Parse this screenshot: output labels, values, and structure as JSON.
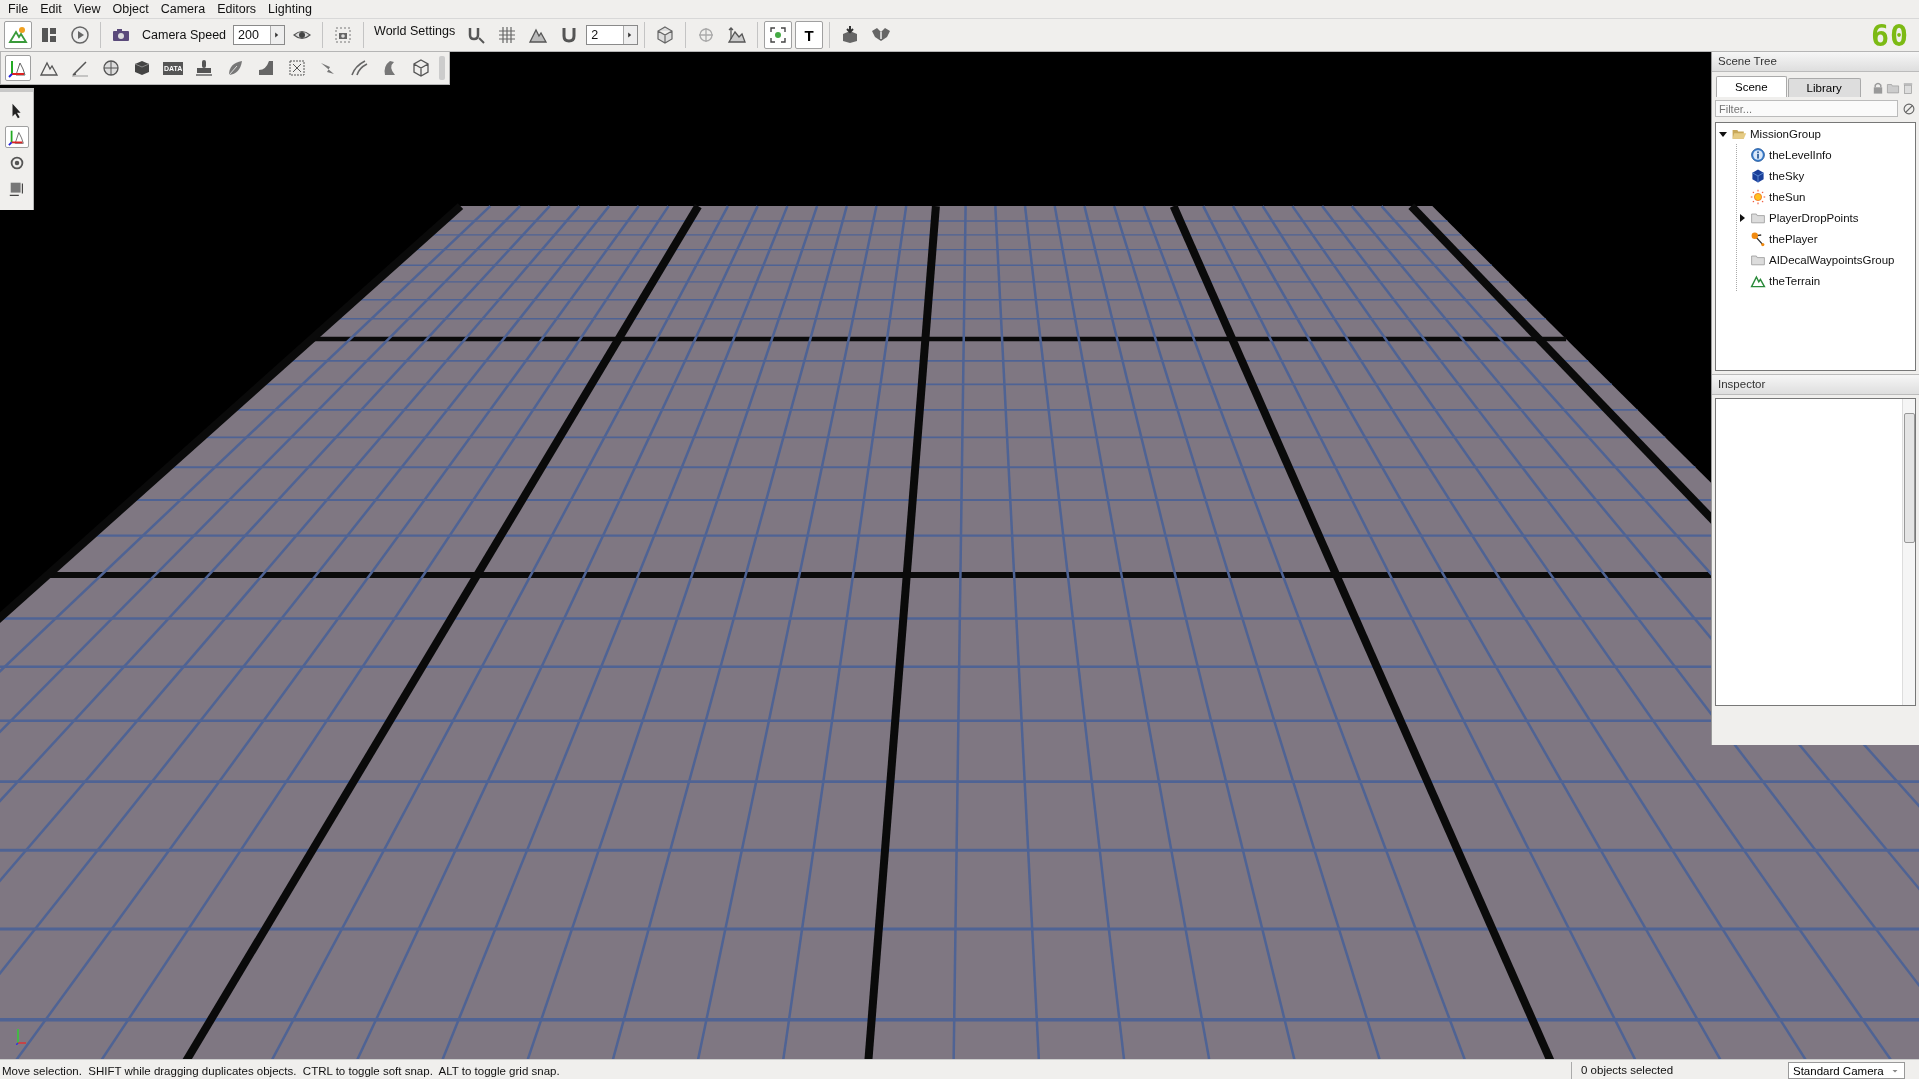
{
  "menu_bar": [
    "File",
    "Edit",
    "View",
    "Object",
    "Camera",
    "Editors",
    "Lighting"
  ],
  "main_toolbar": [
    {
      "kind": "button",
      "selected": true
    },
    {
      "kind": "button",
      "selected": false
    },
    {
      "kind": "button",
      "selected": false
    },
    {
      "kind": "separator"
    },
    {
      "kind": "button",
      "selected": false
    },
    {
      "kind": "label",
      "text": "Camera Speed"
    },
    {
      "kind": "spin",
      "value": "200"
    },
    {
      "kind": "button",
      "selected": false
    },
    {
      "kind": "separator"
    },
    {
      "kind": "button",
      "selected": false
    },
    {
      "kind": "separator"
    },
    {
      "kind": "label",
      "text": "World Settings"
    },
    {
      "kind": "button",
      "selected": false
    },
    {
      "kind": "button",
      "selected": false
    },
    {
      "kind": "button",
      "selected": false
    },
    {
      "kind": "button",
      "selected": false
    },
    {
      "kind": "spin",
      "value": "2"
    },
    {
      "kind": "separator"
    },
    {
      "kind": "button",
      "selected": false
    },
    {
      "kind": "separator"
    },
    {
      "kind": "button",
      "selected": false
    },
    {
      "kind": "button",
      "selected": false
    },
    {
      "kind": "separator"
    },
    {
      "kind": "button",
      "selected": true
    },
    {
      "kind": "button",
      "selected": true,
      "text": "T"
    },
    {
      "kind": "separator"
    },
    {
      "kind": "button",
      "selected": false
    },
    {
      "kind": "button",
      "selected": false
    }
  ],
  "fps": "60",
  "tool_palette": [
    {
      "selected": true
    },
    {
      "selected": false
    },
    {
      "selected": false
    },
    {
      "selected": false
    },
    {
      "selected": false
    },
    {
      "selected": false,
      "text": "DATA"
    },
    {
      "selected": false
    },
    {
      "selected": false
    },
    {
      "selected": false
    },
    {
      "selected": false
    },
    {
      "selected": false
    },
    {
      "selected": false
    },
    {
      "selected": false
    },
    {
      "selected": false
    }
  ],
  "side_toolbar": [
    {
      "selected": false
    },
    {
      "selected": true
    },
    {
      "selected": false
    },
    {
      "selected": false
    }
  ],
  "scene_tree": {
    "title": "Scene Tree",
    "tabs": [
      {
        "label": "Scene",
        "selected": true
      },
      {
        "label": "Library",
        "selected": false
      }
    ],
    "filter": {
      "placeholder": "Filter..."
    },
    "items": [
      {
        "label": "MissionGroup",
        "kind": "group",
        "expanded": true,
        "children": [
          {
            "label": "theLevelInfo",
            "kind": "level-info"
          },
          {
            "label": "theSky",
            "kind": "sky"
          },
          {
            "label": "theSun",
            "kind": "sun"
          },
          {
            "label": "PlayerDropPoints",
            "kind": "group",
            "expanded": false
          },
          {
            "label": "thePlayer",
            "kind": "player"
          },
          {
            "label": "AIDecalWaypointsGroup",
            "kind": "group"
          },
          {
            "label": "theTerrain",
            "kind": "terrain"
          }
        ]
      }
    ]
  },
  "inspector": {
    "title": "Inspector"
  },
  "status_bar": {
    "message": "Move selection.  SHIFT while dragging duplicates objects.  CTRL to toggle soft snap.  ALT to toggle grid snap.",
    "selection": "0 objects selected",
    "camera": "Standard Camera"
  }
}
